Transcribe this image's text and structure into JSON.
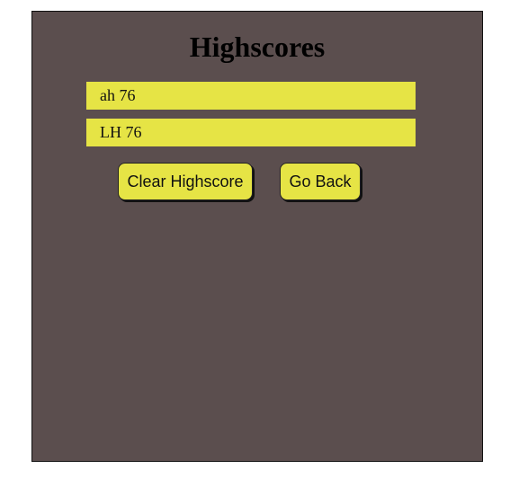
{
  "page": {
    "title": "Highscores"
  },
  "scores": [
    {
      "text": "ah 76"
    },
    {
      "text": "LH 76"
    }
  ],
  "buttons": {
    "clear_label": "Clear Highscore",
    "back_label": "Go Back"
  },
  "colors": {
    "panel_background": "#5b4e4e",
    "accent_yellow": "#e6e445",
    "text": "#111111"
  }
}
